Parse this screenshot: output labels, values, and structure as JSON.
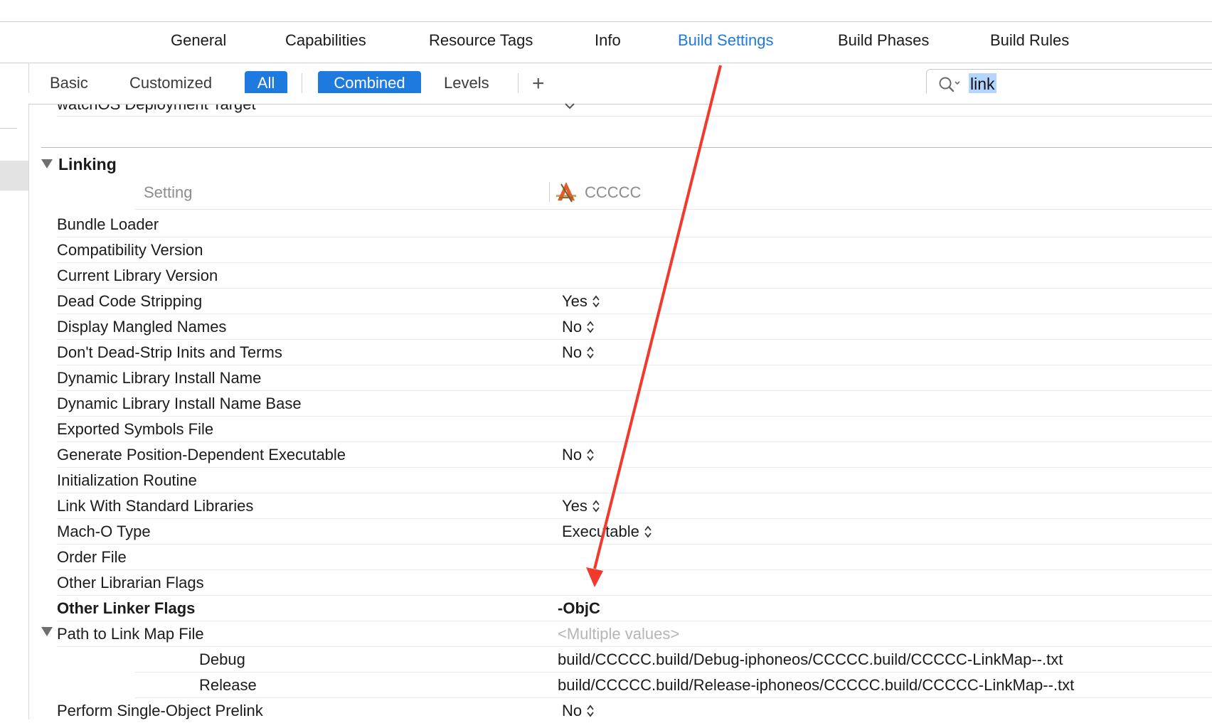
{
  "tabs": [
    "General",
    "Capabilities",
    "Resource Tags",
    "Info",
    "Build Settings",
    "Build Phases",
    "Build Rules"
  ],
  "active_tab": "Build Settings",
  "filters": {
    "basic": "Basic",
    "customized": "Customized",
    "all": "All",
    "combined": "Combined",
    "levels": "Levels",
    "add": "+"
  },
  "search": {
    "value": "link"
  },
  "previous_row": {
    "name": "watchOS Deployment Target"
  },
  "section": {
    "title": "Linking",
    "col_setting": "Setting",
    "col_target": "CCCCC"
  },
  "rows": [
    {
      "name": "Bundle Loader",
      "value": ""
    },
    {
      "name": "Compatibility Version",
      "value": ""
    },
    {
      "name": "Current Library Version",
      "value": ""
    },
    {
      "name": "Dead Code Stripping",
      "value": "Yes"
    },
    {
      "name": "Display Mangled Names",
      "value": "No"
    },
    {
      "name": "Don't Dead-Strip Inits and Terms",
      "value": "No"
    },
    {
      "name": "Dynamic Library Install Name",
      "value": ""
    },
    {
      "name": "Dynamic Library Install Name Base",
      "value": ""
    },
    {
      "name": "Exported Symbols File",
      "value": ""
    },
    {
      "name": "Generate Position-Dependent Executable",
      "value": "No"
    },
    {
      "name": "Initialization Routine",
      "value": ""
    },
    {
      "name": "Link With Standard Libraries",
      "value": "Yes"
    },
    {
      "name": "Mach-O Type",
      "value": "Executable"
    },
    {
      "name": "Order File",
      "value": ""
    },
    {
      "name": "Other Librarian Flags",
      "value": ""
    },
    {
      "name": "Other Linker Flags",
      "value": "-ObjC"
    },
    {
      "name": "Path to Link Map File",
      "value": "<Multiple values>"
    },
    {
      "name": "Perform Single-Object Prelink",
      "value": "No"
    }
  ],
  "subrows": [
    {
      "name": "Debug",
      "value": "build/CCCCC.build/Debug-iphoneos/CCCCC.build/CCCCC-LinkMap--.txt"
    },
    {
      "name": "Release",
      "value": "build/CCCCC.build/Release-iphoneos/CCCCC.build/CCCCC-LinkMap--.txt"
    }
  ],
  "colors": {
    "accent": "#1f7ae0",
    "selection": "#b3d5ff",
    "annotation_arrow": "#f2392b"
  },
  "icons": [
    "search-icon",
    "disclosure-triangle-icon",
    "stepper-icon",
    "chevron-down-icon",
    "app-target-icon",
    "annotation-arrow"
  ]
}
